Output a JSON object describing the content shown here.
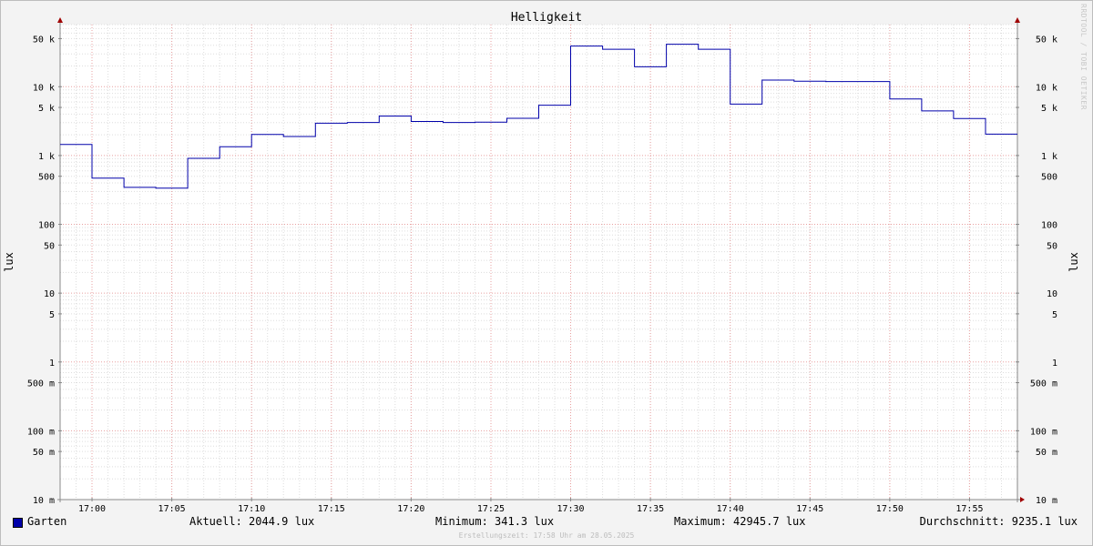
{
  "chart_data": {
    "type": "line",
    "title": "Helligkeit",
    "ylabel_left": "lux",
    "ylabel_right": "lux",
    "yscale": "log",
    "ylim": [
      0.01,
      80000
    ],
    "xlim": [
      "16:58",
      "17:58"
    ],
    "x_ticks": [
      "17:00",
      "17:05",
      "17:10",
      "17:15",
      "17:20",
      "17:25",
      "17:30",
      "17:35",
      "17:40",
      "17:45",
      "17:50",
      "17:55"
    ],
    "y_ticks": [
      {
        "value": 50000,
        "label": "50 k"
      },
      {
        "value": 10000,
        "label": "10 k"
      },
      {
        "value": 5000,
        "label": "5 k"
      },
      {
        "value": 1000,
        "label": "1 k"
      },
      {
        "value": 500,
        "label": "500"
      },
      {
        "value": 100,
        "label": "100"
      },
      {
        "value": 50,
        "label": "50"
      },
      {
        "value": 10,
        "label": "10"
      },
      {
        "value": 5,
        "label": "5"
      },
      {
        "value": 1,
        "label": "1"
      },
      {
        "value": 0.5,
        "label": "500 m"
      },
      {
        "value": 0.1,
        "label": "100 m"
      },
      {
        "value": 0.05,
        "label": "50 m"
      },
      {
        "value": 0.01,
        "label": "10 m"
      }
    ],
    "grid": true,
    "series": [
      {
        "name": "Garten",
        "color": "#0000aa",
        "step": true,
        "x": [
          "16:58",
          "17:00",
          "17:02",
          "17:04",
          "17:06",
          "17:08",
          "17:10",
          "17:12",
          "17:14",
          "17:16",
          "17:18",
          "17:20",
          "17:22",
          "17:24",
          "17:26",
          "17:28",
          "17:30",
          "17:32",
          "17:34",
          "17:36",
          "17:38",
          "17:40",
          "17:42",
          "17:44",
          "17:46",
          "17:48",
          "17:50",
          "17:52",
          "17:54",
          "17:56",
          "17:58"
        ],
        "values": [
          1450,
          470,
          345,
          335,
          910,
          1340,
          2020,
          1890,
          2950,
          3020,
          3750,
          3120,
          3020,
          3050,
          3480,
          5380,
          39000,
          35000,
          19500,
          41500,
          35000,
          5580,
          12500,
          12000,
          11900,
          11900,
          6650,
          4450,
          3450,
          2044.9,
          2044.9
        ]
      }
    ],
    "legend_position": "bottom-left"
  },
  "legend": {
    "series_name": "Garten",
    "color": "#0000aa",
    "current": "Aktuell: 2044.9 lux",
    "minimum": "Minimum: 341.3 lux",
    "maximum": "Maximum: 42945.7 lux",
    "average": "Durchschnitt: 9235.1 lux"
  },
  "footer": "Erstellungszeit: 17:58 Uhr am 28.05.2025",
  "watermark": "RRDTOOL / TOBI OETIKER"
}
